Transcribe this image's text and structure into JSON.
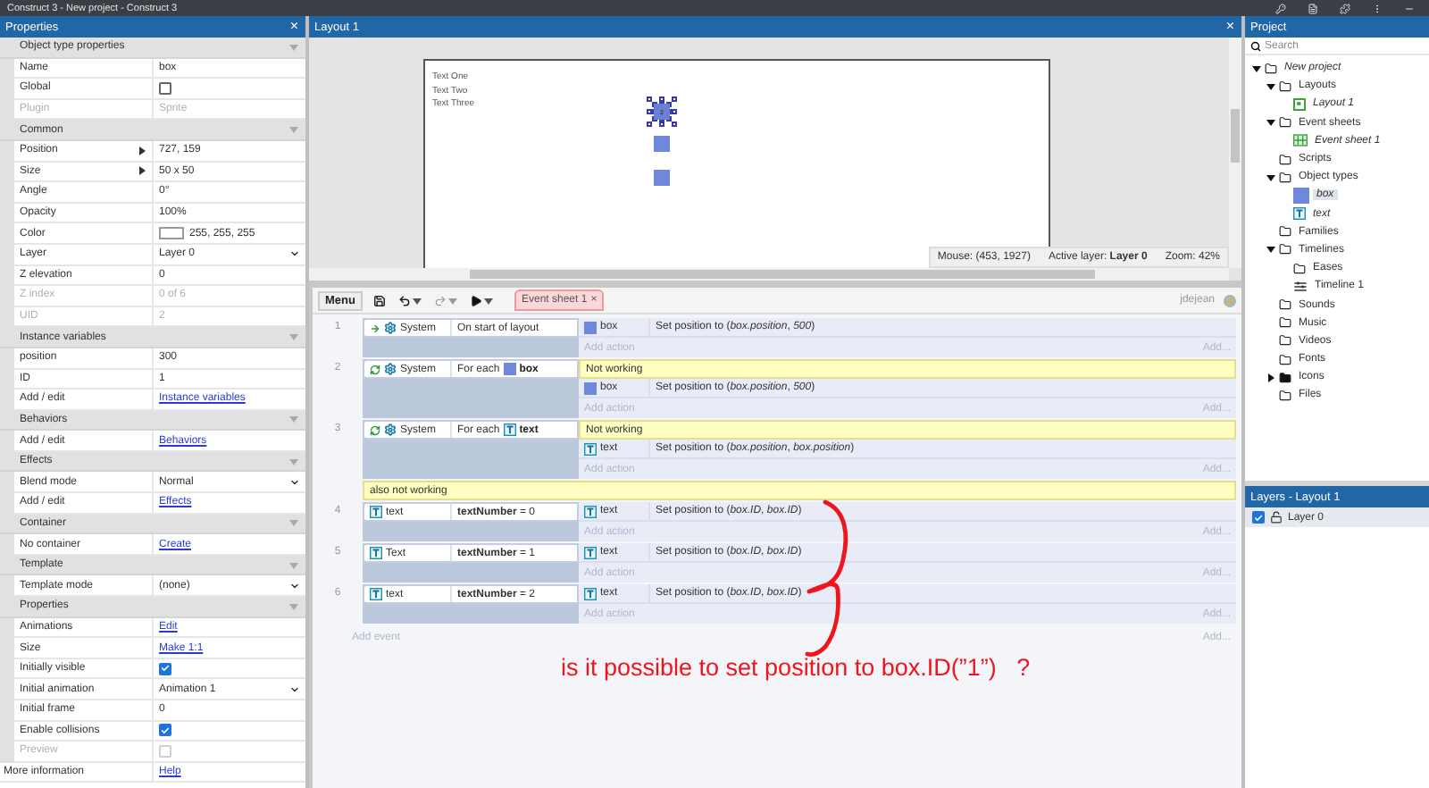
{
  "window": {
    "title": "Construct 3 - New project - Construct 3"
  },
  "properties": {
    "title": "Properties",
    "close": "×",
    "sections": [
      {
        "title": "Object type properties",
        "rows": [
          {
            "label": "Name",
            "kind": "text",
            "value": "box",
            "disabled": false
          },
          {
            "label": "Global",
            "kind": "checkbox",
            "checked": false,
            "disabled": false
          },
          {
            "label": "Plugin",
            "kind": "text",
            "value": "Sprite",
            "disabled": true
          }
        ]
      },
      {
        "title": "Common",
        "rows": [
          {
            "label": "Position",
            "kind": "expand",
            "value": "727, 159",
            "disabled": false
          },
          {
            "label": "Size",
            "kind": "expand",
            "value": "50 x 50",
            "disabled": false
          },
          {
            "label": "Angle",
            "kind": "text",
            "value": "0°",
            "disabled": false
          },
          {
            "label": "Opacity",
            "kind": "text",
            "value": "100%",
            "disabled": false
          },
          {
            "label": "Color",
            "kind": "color",
            "value": "255, 255, 255",
            "disabled": false
          },
          {
            "label": "Layer",
            "kind": "select",
            "value": "Layer 0",
            "disabled": false
          },
          {
            "label": "Z elevation",
            "kind": "text",
            "value": "0",
            "disabled": false
          },
          {
            "label": "Z index",
            "kind": "text",
            "value": "0 of 6",
            "disabled": true
          },
          {
            "label": "UID",
            "kind": "text",
            "value": "2",
            "disabled": true
          }
        ]
      },
      {
        "title": "Instance variables",
        "rows": [
          {
            "label": "position",
            "kind": "text",
            "value": "300",
            "disabled": false
          },
          {
            "label": "ID",
            "kind": "text",
            "value": "1",
            "disabled": false
          },
          {
            "label": "Add / edit",
            "kind": "link",
            "value": "Instance variables",
            "disabled": false
          }
        ]
      },
      {
        "title": "Behaviors",
        "rows": [
          {
            "label": "Add / edit",
            "kind": "link",
            "value": "Behaviors",
            "disabled": false
          }
        ]
      },
      {
        "title": "Effects",
        "rows": [
          {
            "label": "Blend mode",
            "kind": "select",
            "value": "Normal",
            "disabled": false
          },
          {
            "label": "Add / edit",
            "kind": "link",
            "value": "Effects",
            "disabled": false
          }
        ]
      },
      {
        "title": "Container",
        "rows": [
          {
            "label": "No container",
            "kind": "link",
            "value": "Create",
            "disabled": false
          }
        ]
      },
      {
        "title": "Template",
        "rows": [
          {
            "label": "Template mode",
            "kind": "select",
            "value": "(none)",
            "disabled": false
          }
        ]
      },
      {
        "title": "Properties",
        "rows": [
          {
            "label": "Animations",
            "kind": "link",
            "value": "Edit",
            "disabled": false
          },
          {
            "label": "Size",
            "kind": "link",
            "value": "Make 1:1",
            "disabled": false
          },
          {
            "label": "Initially visible",
            "kind": "checkbox",
            "checked": true,
            "disabled": false
          },
          {
            "label": "Initial animation",
            "kind": "select",
            "value": "Animation 1",
            "disabled": false
          },
          {
            "label": "Initial frame",
            "kind": "text",
            "value": "0",
            "disabled": false
          },
          {
            "label": "Enable collisions",
            "kind": "checkbox",
            "checked": true,
            "disabled": false
          },
          {
            "label": "Preview",
            "kind": "checkbox",
            "checked": false,
            "disabled": true
          }
        ]
      }
    ],
    "footer": {
      "label": "More information",
      "link": "Help"
    }
  },
  "layout": {
    "title": "Layout 1",
    "close": "×",
    "texts": [
      "Text One",
      "Text Two",
      "Text Three"
    ],
    "objects": [
      {
        "selected": true,
        "label": "2"
      },
      {
        "selected": false
      },
      {
        "selected": false
      }
    ],
    "status": {
      "mouse": "Mouse: (453, 1927)",
      "layer": "Active layer: **Layer 0**",
      "zoom": "Zoom: 42%"
    }
  },
  "event_sheet": {
    "menu": "Menu",
    "tab": {
      "label": "Event sheet 1",
      "close": "×"
    },
    "user": "jdejean",
    "events": [
      {
        "kind": "event",
        "number": "1",
        "object": {
          "kind": "system",
          "label": "System"
        },
        "condition": {
          "kind": "trigger",
          "text": "On start of layout"
        },
        "actions": [
          {
            "kind": "sprite",
            "object": "box",
            "text": "Set position to (*box.position*, *500*)"
          }
        ],
        "add_action": "Add action",
        "add_more": "Add..."
      },
      {
        "kind": "event",
        "number": "2",
        "object": {
          "kind": "system",
          "label": "System"
        },
        "condition": {
          "kind": "loop",
          "text": "For each",
          "param": {
            "kind": "sprite",
            "label": "box"
          }
        },
        "comment": "Not working",
        "actions": [
          {
            "kind": "sprite",
            "object": "box",
            "text": "Set position to (*box.position*, *500*)"
          }
        ],
        "add_action": "Add action",
        "add_more": "Add..."
      },
      {
        "kind": "event",
        "number": "3",
        "object": {
          "kind": "system",
          "label": "System"
        },
        "condition": {
          "kind": "loop",
          "text": "For each",
          "param": {
            "kind": "text",
            "label": "text"
          }
        },
        "comment": "Not working",
        "actions": [
          {
            "kind": "text",
            "object": "text",
            "text": "Set position to (*box.position*, *box.position*)"
          }
        ],
        "add_action": "Add action",
        "add_more": "Add..."
      },
      {
        "kind": "comment",
        "text": "also not working"
      },
      {
        "kind": "event",
        "number": "4",
        "object": {
          "kind": "text",
          "label": "text"
        },
        "condition": {
          "kind": "compare",
          "text": "**textNumber** = 0"
        },
        "actions": [
          {
            "kind": "text",
            "object": "text",
            "text": "Set position to (*box.ID*, *box.ID*)"
          }
        ],
        "add_action": "Add action",
        "add_more": "Add..."
      },
      {
        "kind": "event",
        "number": "5",
        "object": {
          "kind": "text",
          "label": "Text"
        },
        "condition": {
          "kind": "compare",
          "text": "**textNumber** = 1"
        },
        "actions": [
          {
            "kind": "text",
            "object": "text",
            "text": "Set position to (*box.ID*, *box.ID*)"
          }
        ],
        "add_action": "Add action",
        "add_more": "Add..."
      },
      {
        "kind": "event",
        "number": "6",
        "object": {
          "kind": "text",
          "label": "text"
        },
        "condition": {
          "kind": "compare",
          "text": "**textNumber** = 2"
        },
        "actions": [
          {
            "kind": "text",
            "object": "text",
            "text": "Set position to (*box.ID*, *box.ID*)"
          }
        ],
        "add_action": "Add action",
        "add_more": "Add..."
      }
    ],
    "add_event": "Add event",
    "add_event_more": "Add..."
  },
  "annotation": {
    "text": "is it possible to set position to box.ID(”1”)   ?"
  },
  "project": {
    "title": "Project",
    "search": {
      "placeholder": "Search"
    },
    "tree": [
      {
        "label": "New project",
        "kind": "project",
        "expanded": true,
        "selected": false,
        "children": [
          {
            "label": "Layouts",
            "kind": "folder",
            "expanded": true,
            "selected": false,
            "children": [
              {
                "label": "Layout 1",
                "kind": "layout",
                "selected": false
              }
            ]
          },
          {
            "label": "Event sheets",
            "kind": "folder",
            "expanded": true,
            "selected": false,
            "children": [
              {
                "label": "Event sheet 1",
                "kind": "eventsheet",
                "selected": false
              }
            ]
          },
          {
            "label": "Scripts",
            "kind": "folder",
            "selected": false
          },
          {
            "label": "Object types",
            "kind": "folder",
            "expanded": true,
            "selected": false,
            "children": [
              {
                "label": "box",
                "kind": "sprite",
                "selected": true
              },
              {
                "label": "text",
                "kind": "text",
                "selected": false
              }
            ]
          },
          {
            "label": "Families",
            "kind": "folder",
            "selected": false
          },
          {
            "label": "Timelines",
            "kind": "folder",
            "expanded": true,
            "selected": false,
            "children": [
              {
                "label": "Eases",
                "kind": "folder",
                "selected": false
              },
              {
                "label": "Timeline 1",
                "kind": "timeline",
                "selected": false
              }
            ]
          },
          {
            "label": "Sounds",
            "kind": "folder",
            "selected": false
          },
          {
            "label": "Music",
            "kind": "folder",
            "selected": false
          },
          {
            "label": "Videos",
            "kind": "folder",
            "selected": false
          },
          {
            "label": "Fonts",
            "kind": "folder",
            "selected": false
          },
          {
            "label": "Icons",
            "kind": "folder",
            "expanded": false,
            "selected": false
          },
          {
            "label": "Files",
            "kind": "folder",
            "selected": false
          }
        ]
      }
    ]
  },
  "layers": {
    "title": "Layers - Layout 1",
    "items": [
      {
        "name": "Layer 0",
        "visible": true,
        "selected": true
      }
    ]
  }
}
